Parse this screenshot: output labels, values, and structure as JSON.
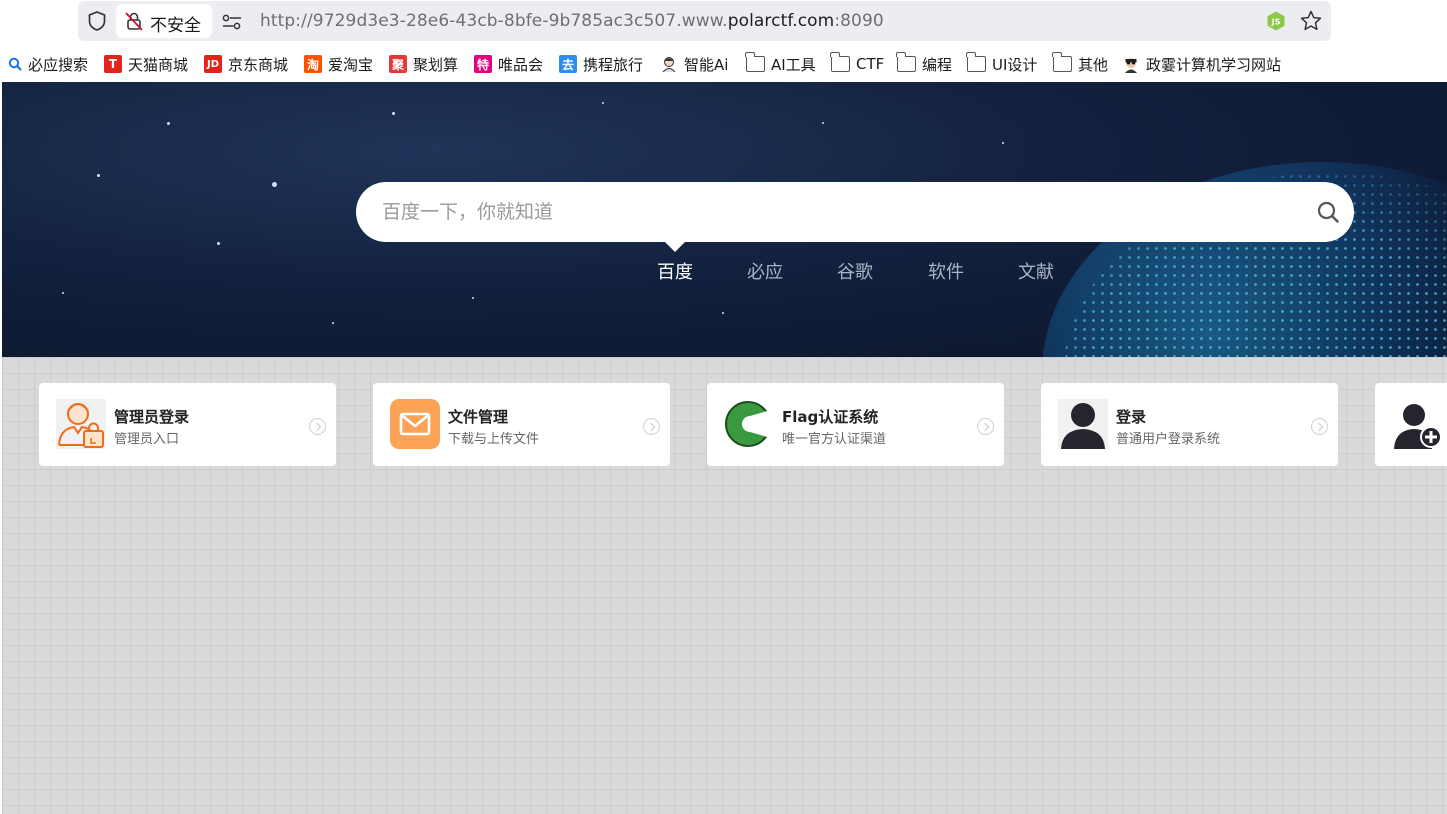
{
  "address_bar": {
    "security_label": "不安全",
    "url_prefix": "http://9729d3e3-28e6-43cb-8bfe-9b785ac3c507.www.",
    "url_host": "polarctf.com",
    "url_port": ":8090"
  },
  "bookmarks": [
    {
      "label": "必应搜索",
      "icon": "bing-search-icon"
    },
    {
      "label": "天猫商城",
      "icon": "tmall-icon",
      "glyph": "T",
      "color": "#e1251b"
    },
    {
      "label": "京东商城",
      "icon": "jd-icon",
      "glyph": "JD",
      "color": "#e1251b"
    },
    {
      "label": "爱淘宝",
      "icon": "taobao-icon",
      "glyph": "淘",
      "color": "#ff5000"
    },
    {
      "label": "聚划算",
      "icon": "juhuasuan-icon",
      "glyph": "聚",
      "color": "#e4393c"
    },
    {
      "label": "唯品会",
      "icon": "vipshop-icon",
      "glyph": "特",
      "color": "#e5007f"
    },
    {
      "label": "携程旅行",
      "icon": "ctrip-icon",
      "glyph": "去",
      "color": "#2d8cf0"
    },
    {
      "label": "智能Ai",
      "icon": "ai-avatar-icon"
    },
    {
      "label": "AI工具",
      "icon": "folder-icon"
    },
    {
      "label": "CTF",
      "icon": "folder-icon"
    },
    {
      "label": "编程",
      "icon": "folder-icon"
    },
    {
      "label": "UI设计",
      "icon": "folder-icon"
    },
    {
      "label": "其他",
      "icon": "folder-icon"
    },
    {
      "label": "政霎计算机学习网站",
      "icon": "site-avatar-icon"
    }
  ],
  "search": {
    "placeholder": "百度一下，你就知道",
    "engines": [
      "百度",
      "必应",
      "谷歌",
      "软件",
      "文献"
    ],
    "active_engine": "百度"
  },
  "cards": [
    {
      "title": "管理员登录",
      "subtitle": "管理员入口",
      "icon": "admin-user-icon"
    },
    {
      "title": "文件管理",
      "subtitle": "下载与上传文件",
      "icon": "mail-icon"
    },
    {
      "title": "Flag认证系统",
      "subtitle": "唯一官方认证渠道",
      "icon": "flag-c-logo-icon"
    },
    {
      "title": "登录",
      "subtitle": "普通用户登录系统",
      "icon": "user-icon"
    },
    {
      "title": "",
      "subtitle": "",
      "icon": "add-user-icon"
    }
  ]
}
